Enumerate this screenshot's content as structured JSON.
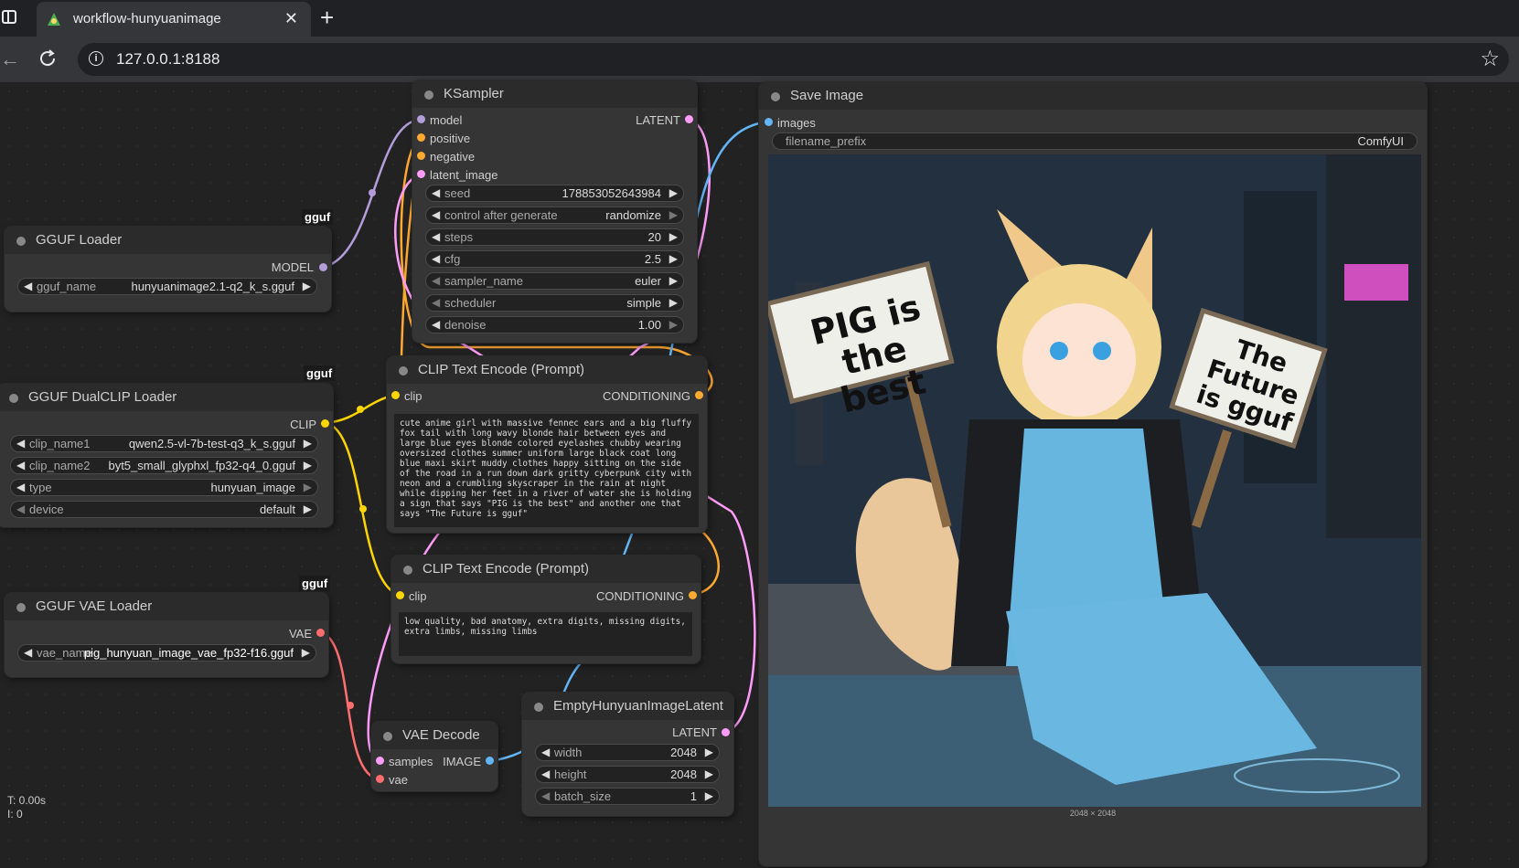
{
  "browser": {
    "tab_title": "workflow-hunyuanimage",
    "url": "127.0.0.1:8188"
  },
  "icons": {
    "sidebar": "sidebar-icon",
    "tab_favicon": "comfyui-favicon",
    "close": "close-icon",
    "new_tab": "plus-icon",
    "back": "back-arrow-icon",
    "reload": "reload-icon",
    "site_info": "info-icon",
    "bookmark": "star-icon"
  },
  "colors": {
    "model": "#b39ddb",
    "conditioning": "#ffa931",
    "latent": "#ff9cf9",
    "clip": "#ffd500",
    "vae": "#ff6e6e",
    "image": "#64b5f6"
  },
  "nodes": {
    "ksampler": {
      "title": "KSampler",
      "inputs": [
        "model",
        "positive",
        "negative",
        "latent_image"
      ],
      "output": "LATENT",
      "widgets": [
        {
          "label": "seed",
          "value": "178853052643984"
        },
        {
          "label": "control after generate",
          "value": "randomize"
        },
        {
          "label": "steps",
          "value": "20"
        },
        {
          "label": "cfg",
          "value": "2.5"
        },
        {
          "label": "sampler_name",
          "value": "euler"
        },
        {
          "label": "scheduler",
          "value": "simple"
        },
        {
          "label": "denoise",
          "value": "1.00"
        }
      ]
    },
    "gguf_loader": {
      "badge": "gguf",
      "title": "GGUF Loader",
      "output": "MODEL",
      "widgets": [
        {
          "label": "gguf_name",
          "value": "hunyuanimage2.1-q2_k_s.gguf"
        }
      ]
    },
    "dualclip": {
      "badge": "gguf",
      "title": "GGUF DualCLIP Loader",
      "output": "CLIP",
      "widgets": [
        {
          "label": "clip_name1",
          "value": "qwen2.5-vl-7b-test-q3_k_s.gguf"
        },
        {
          "label": "clip_name2",
          "value": "byt5_small_glyphxl_fp32-q4_0.gguf"
        },
        {
          "label": "type",
          "value": "hunyuan_image"
        },
        {
          "label": "device",
          "value": "default"
        }
      ]
    },
    "vae_loader": {
      "badge": "gguf",
      "title": "GGUF VAE Loader",
      "output": "VAE",
      "widgets": [
        {
          "label": "vae_name",
          "value": "pig_hunyuan_image_vae_fp32-f16.gguf"
        }
      ]
    },
    "clip_pos": {
      "title": "CLIP Text Encode (Prompt)",
      "input": "clip",
      "output": "CONDITIONING",
      "text": "cute anime girl with massive fennec ears and a big fluffy fox tail with long wavy blonde hair between eyes and large blue eyes blonde colored eyelashes chubby wearing oversized clothes summer uniform large black coat long blue maxi skirt muddy clothes happy sitting on the side of the road in a run down dark gritty cyberpunk city with neon and a crumbling skyscraper in the rain at night while dipping her feet in a river of water she is holding a sign that says \"PIG is the best\" and another one that says \"The Future is gguf\""
    },
    "clip_neg": {
      "title": "CLIP Text Encode (Prompt)",
      "input": "clip",
      "output": "CONDITIONING",
      "text": "low quality, bad anatomy, extra digits, missing digits, extra limbs, missing limbs"
    },
    "vae_decode": {
      "title": "VAE Decode",
      "inputs": [
        "samples",
        "vae"
      ],
      "output": "IMAGE"
    },
    "empty_latent": {
      "title": "EmptyHunyuanImageLatent",
      "output": "LATENT",
      "widgets": [
        {
          "label": "width",
          "value": "2048"
        },
        {
          "label": "height",
          "value": "2048"
        },
        {
          "label": "batch_size",
          "value": "1"
        }
      ]
    },
    "save_image": {
      "title": "Save Image",
      "input": "images",
      "widgets": [
        {
          "label": "filename_prefix",
          "value": "ComfyUI"
        }
      ],
      "image": {
        "sign1": "PIG is the best",
        "sign2": "The Future is gguf",
        "caption": "2048 × 2048"
      }
    }
  },
  "status": {
    "time": "T: 0.00s",
    "iterations": "I: 0"
  }
}
